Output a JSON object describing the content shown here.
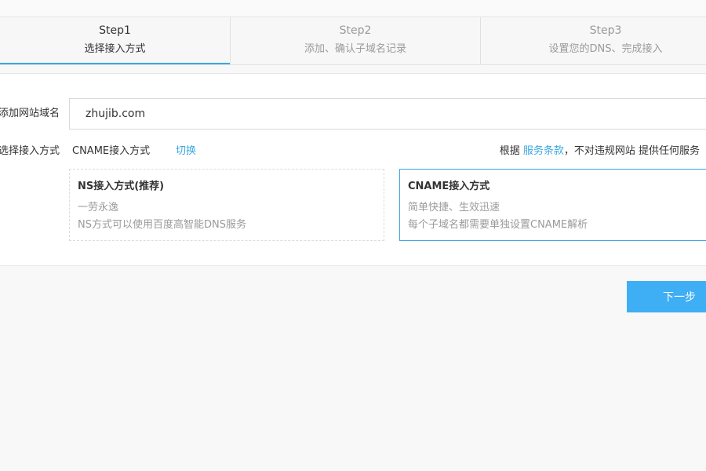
{
  "steps": [
    {
      "num": "Step1",
      "title": "选择接入方式"
    },
    {
      "num": "Step2",
      "title": "添加、确认子域名记录"
    },
    {
      "num": "Step3",
      "title": "设置您的DNS、完成接入"
    }
  ],
  "form": {
    "domain_label": "添加网站域名",
    "domain_value": "zhujib.com",
    "method_label": "选择接入方式",
    "method_current": "CNAME接入方式",
    "switch_label": "切换",
    "terms_prefix": "根据 ",
    "terms_link": "服务条款",
    "terms_suffix": "，不对违规网站 提供任何服务"
  },
  "cards": {
    "ns": {
      "title": "NS接入方式(推荐)",
      "line1": "一劳永逸",
      "line2": "NS方式可以使用百度高智能DNS服务"
    },
    "cname": {
      "title": "CNAME接入方式",
      "line1": "简单快捷、生效迅速",
      "line2": "每个子域名都需要单独设置CNAME解析",
      "check_glyph": "✓"
    }
  },
  "actions": {
    "next_label": "下一步"
  },
  "colors": {
    "accent": "#3ba7e0",
    "button": "#3eaef5"
  }
}
